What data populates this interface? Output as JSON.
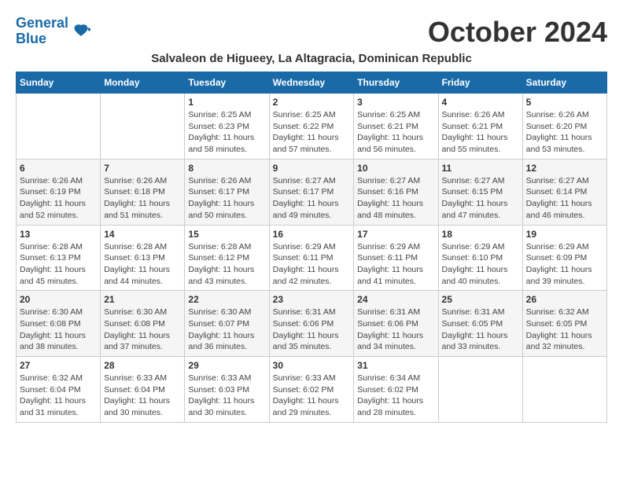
{
  "logo": {
    "line1": "General",
    "line2": "Blue"
  },
  "title": "October 2024",
  "subtitle": "Salvaleon de Higueey, La Altagracia, Dominican Republic",
  "header_days": [
    "Sunday",
    "Monday",
    "Tuesday",
    "Wednesday",
    "Thursday",
    "Friday",
    "Saturday"
  ],
  "weeks": [
    [
      {
        "day": "",
        "info": ""
      },
      {
        "day": "",
        "info": ""
      },
      {
        "day": "1",
        "info": "Sunrise: 6:25 AM\nSunset: 6:23 PM\nDaylight: 11 hours and 58 minutes."
      },
      {
        "day": "2",
        "info": "Sunrise: 6:25 AM\nSunset: 6:22 PM\nDaylight: 11 hours and 57 minutes."
      },
      {
        "day": "3",
        "info": "Sunrise: 6:25 AM\nSunset: 6:21 PM\nDaylight: 11 hours and 56 minutes."
      },
      {
        "day": "4",
        "info": "Sunrise: 6:26 AM\nSunset: 6:21 PM\nDaylight: 11 hours and 55 minutes."
      },
      {
        "day": "5",
        "info": "Sunrise: 6:26 AM\nSunset: 6:20 PM\nDaylight: 11 hours and 53 minutes."
      }
    ],
    [
      {
        "day": "6",
        "info": "Sunrise: 6:26 AM\nSunset: 6:19 PM\nDaylight: 11 hours and 52 minutes."
      },
      {
        "day": "7",
        "info": "Sunrise: 6:26 AM\nSunset: 6:18 PM\nDaylight: 11 hours and 51 minutes."
      },
      {
        "day": "8",
        "info": "Sunrise: 6:26 AM\nSunset: 6:17 PM\nDaylight: 11 hours and 50 minutes."
      },
      {
        "day": "9",
        "info": "Sunrise: 6:27 AM\nSunset: 6:17 PM\nDaylight: 11 hours and 49 minutes."
      },
      {
        "day": "10",
        "info": "Sunrise: 6:27 AM\nSunset: 6:16 PM\nDaylight: 11 hours and 48 minutes."
      },
      {
        "day": "11",
        "info": "Sunrise: 6:27 AM\nSunset: 6:15 PM\nDaylight: 11 hours and 47 minutes."
      },
      {
        "day": "12",
        "info": "Sunrise: 6:27 AM\nSunset: 6:14 PM\nDaylight: 11 hours and 46 minutes."
      }
    ],
    [
      {
        "day": "13",
        "info": "Sunrise: 6:28 AM\nSunset: 6:13 PM\nDaylight: 11 hours and 45 minutes."
      },
      {
        "day": "14",
        "info": "Sunrise: 6:28 AM\nSunset: 6:13 PM\nDaylight: 11 hours and 44 minutes."
      },
      {
        "day": "15",
        "info": "Sunrise: 6:28 AM\nSunset: 6:12 PM\nDaylight: 11 hours and 43 minutes."
      },
      {
        "day": "16",
        "info": "Sunrise: 6:29 AM\nSunset: 6:11 PM\nDaylight: 11 hours and 42 minutes."
      },
      {
        "day": "17",
        "info": "Sunrise: 6:29 AM\nSunset: 6:11 PM\nDaylight: 11 hours and 41 minutes."
      },
      {
        "day": "18",
        "info": "Sunrise: 6:29 AM\nSunset: 6:10 PM\nDaylight: 11 hours and 40 minutes."
      },
      {
        "day": "19",
        "info": "Sunrise: 6:29 AM\nSunset: 6:09 PM\nDaylight: 11 hours and 39 minutes."
      }
    ],
    [
      {
        "day": "20",
        "info": "Sunrise: 6:30 AM\nSunset: 6:08 PM\nDaylight: 11 hours and 38 minutes."
      },
      {
        "day": "21",
        "info": "Sunrise: 6:30 AM\nSunset: 6:08 PM\nDaylight: 11 hours and 37 minutes."
      },
      {
        "day": "22",
        "info": "Sunrise: 6:30 AM\nSunset: 6:07 PM\nDaylight: 11 hours and 36 minutes."
      },
      {
        "day": "23",
        "info": "Sunrise: 6:31 AM\nSunset: 6:06 PM\nDaylight: 11 hours and 35 minutes."
      },
      {
        "day": "24",
        "info": "Sunrise: 6:31 AM\nSunset: 6:06 PM\nDaylight: 11 hours and 34 minutes."
      },
      {
        "day": "25",
        "info": "Sunrise: 6:31 AM\nSunset: 6:05 PM\nDaylight: 11 hours and 33 minutes."
      },
      {
        "day": "26",
        "info": "Sunrise: 6:32 AM\nSunset: 6:05 PM\nDaylight: 11 hours and 32 minutes."
      }
    ],
    [
      {
        "day": "27",
        "info": "Sunrise: 6:32 AM\nSunset: 6:04 PM\nDaylight: 11 hours and 31 minutes."
      },
      {
        "day": "28",
        "info": "Sunrise: 6:33 AM\nSunset: 6:04 PM\nDaylight: 11 hours and 30 minutes."
      },
      {
        "day": "29",
        "info": "Sunrise: 6:33 AM\nSunset: 6:03 PM\nDaylight: 11 hours and 30 minutes."
      },
      {
        "day": "30",
        "info": "Sunrise: 6:33 AM\nSunset: 6:02 PM\nDaylight: 11 hours and 29 minutes."
      },
      {
        "day": "31",
        "info": "Sunrise: 6:34 AM\nSunset: 6:02 PM\nDaylight: 11 hours and 28 minutes."
      },
      {
        "day": "",
        "info": ""
      },
      {
        "day": "",
        "info": ""
      }
    ]
  ]
}
